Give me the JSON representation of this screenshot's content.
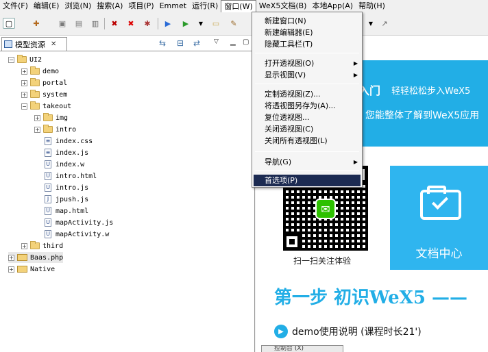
{
  "menubar": {
    "items": [
      {
        "label": "文件(F)"
      },
      {
        "label": "编辑(E)"
      },
      {
        "label": "浏览(N)"
      },
      {
        "label": "搜索(A)"
      },
      {
        "label": "项目(P)"
      },
      {
        "label": "Emmet"
      },
      {
        "label": "运行(R)"
      },
      {
        "label": "窗口(W)"
      },
      {
        "label": "WeX5文档(B)"
      },
      {
        "label": "本地App(A)"
      },
      {
        "label": "帮助(H)"
      }
    ]
  },
  "dropdown": {
    "items": [
      {
        "label": "新建窗口(N)"
      },
      {
        "label": "新建编辑器(E)"
      },
      {
        "label": "隐藏工具栏(T)"
      },
      {
        "label": "打开透视图(O)"
      },
      {
        "label": "显示视图(V)"
      },
      {
        "label": "定制透视图(Z)..."
      },
      {
        "label": "将透视图另存为(A)..."
      },
      {
        "label": "复位透视图..."
      },
      {
        "label": "关闭透视图(C)"
      },
      {
        "label": "关闭所有透视图(L)"
      },
      {
        "label": "导航(G)"
      },
      {
        "label": "首选项(P)"
      }
    ]
  },
  "leftpanel": {
    "tab_label": "模型资源",
    "close": "✕"
  },
  "tree": [
    {
      "label": "UI2"
    },
    {
      "label": "demo"
    },
    {
      "label": "portal"
    },
    {
      "label": "system"
    },
    {
      "label": "takeout"
    },
    {
      "label": "img"
    },
    {
      "label": "intro"
    },
    {
      "label": "index.css"
    },
    {
      "label": "index.js"
    },
    {
      "label": "index.w"
    },
    {
      "label": "intro.html"
    },
    {
      "label": "intro.js"
    },
    {
      "label": "jpush.js"
    },
    {
      "label": "map.html"
    },
    {
      "label": "mapActivity.js"
    },
    {
      "label": "mapActivity.w"
    },
    {
      "label": "third"
    },
    {
      "label": "Baas.php"
    },
    {
      "label": "Native"
    }
  ],
  "content": {
    "banner_title": "入门",
    "banner_sub": "轻轻松松步入WeX5",
    "banner_line2": "您能整体了解到WeX5应用",
    "qr_label": "扫一扫关注体验",
    "doc_center": "文档中心",
    "step_title": "第一步  初识WeX5 ——",
    "demo_text": "demo使用说明 (课程时长21')",
    "bottom_tab": "控制台 (X)"
  },
  "colors": {
    "accent": "#22aee6",
    "menu_highlight": "#1c2b52"
  }
}
